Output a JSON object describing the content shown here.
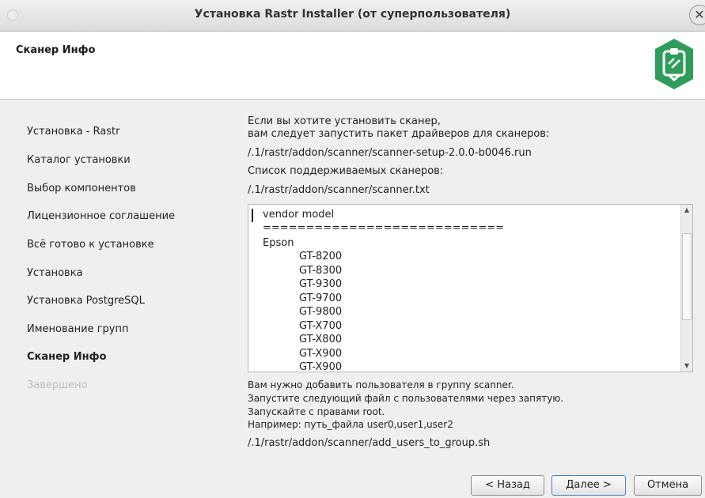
{
  "window": {
    "title": "Установка Rastr Installer (от суперпользователя)"
  },
  "header": {
    "title": "Сканер Инфо",
    "logo_icon": "installer-box-icon"
  },
  "sidebar": {
    "steps": [
      {
        "label": "Установка - Rastr"
      },
      {
        "label": "Каталог установки"
      },
      {
        "label": "Выбор компонентов"
      },
      {
        "label": "Лицензионное соглашение"
      },
      {
        "label": "Всё готово к установке"
      },
      {
        "label": "Установка"
      },
      {
        "label": "Установка PostgreSQL"
      },
      {
        "label": "Именование групп"
      },
      {
        "label": "Сканер Инфо"
      },
      {
        "label": "Завершено"
      }
    ]
  },
  "main": {
    "intro_line1": "Если вы хотите установить сканер,",
    "intro_line2": "вам следует запустить пакет драйверов для сканеров:",
    "driver_path": "/.1/rastr/addon/scanner/scanner-setup-2.0.0-b0046.run",
    "supported_label": "Список поддерживаемых сканеров:",
    "list_path": "/.1/rastr/addon/scanner/scanner.txt",
    "list": {
      "header": "vendor    model",
      "separator": "============================",
      "vendor": "Epson",
      "models": [
        "GT-8200",
        "GT-8300",
        "GT-9300",
        "GT-9700",
        "GT-9800",
        "GT-X700",
        "GT-X800",
        "GT-X900",
        "GT-X900"
      ]
    },
    "group_note1": "Вам нужно добавить пользователя в группу scanner.",
    "group_note2": "Запустите следующий файл с пользователями через запятую.",
    "group_note3": "Запускайте с правами root.",
    "group_note4": "Например: путь_файла user0,user1,user2",
    "script_path": "/.1/rastr/addon/scanner/add_users_to_group.sh"
  },
  "buttons": {
    "back": "< Назад",
    "next": "Далее >",
    "cancel": "Отмена"
  },
  "colors": {
    "logo_green": "#2e9c5a",
    "sidebar_bg": "#efefef"
  }
}
